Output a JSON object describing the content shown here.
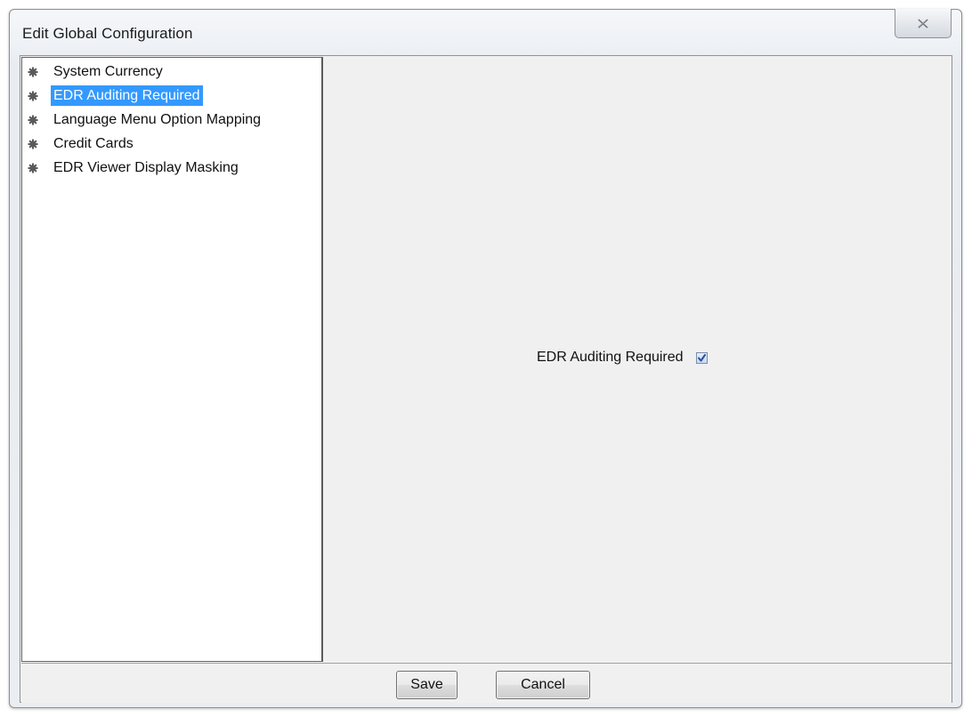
{
  "window": {
    "title": "Edit Global Configuration",
    "close_icon": "close-icon"
  },
  "tree": {
    "bullet_icon": "gear-bullet-icon",
    "items": [
      {
        "label": "System Currency",
        "selected": false
      },
      {
        "label": "EDR Auditing Required",
        "selected": true
      },
      {
        "label": "Language Menu Option Mapping",
        "selected": false
      },
      {
        "label": "Credit Cards",
        "selected": false
      },
      {
        "label": "EDR Viewer Display Masking",
        "selected": false
      }
    ]
  },
  "content": {
    "field_label": "EDR Auditing Required",
    "field_checked": true
  },
  "buttons": {
    "save_label": "Save",
    "cancel_label": "Cancel"
  },
  "colors": {
    "selection": "#3399ff",
    "selection_text": "#ffffff",
    "checkmark": "#2a4f9a"
  }
}
